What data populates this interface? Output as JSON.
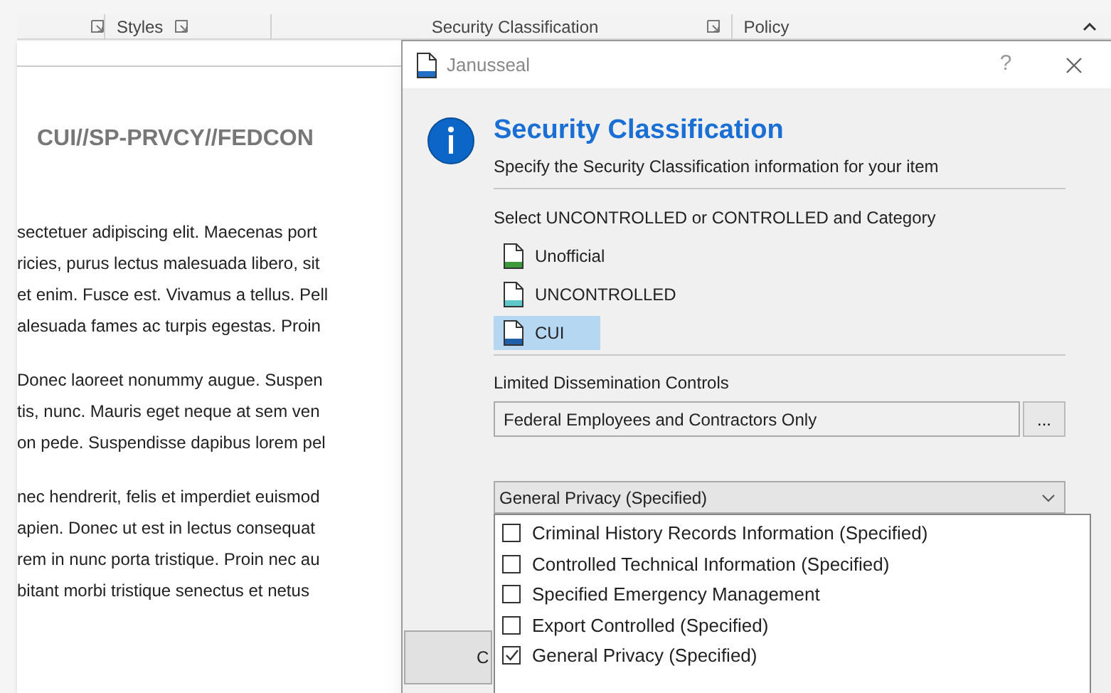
{
  "ribbon": {
    "groups": [
      {
        "label": "Styles",
        "launcher": true
      },
      {
        "label": "Security Classification",
        "launcher": true
      },
      {
        "label": "Policy",
        "launcher": false
      }
    ]
  },
  "document": {
    "banner": "CUI//SP-PRVCY//FEDCON",
    "paragraphs": [
      [
        "sectetuer adipiscing elit. Maecenas port",
        "ricies, purus lectus malesuada libero, sit",
        "et enim. Fusce est. Vivamus a tellus. Pell",
        "alesuada fames ac turpis egestas. Proin"
      ],
      [
        "Donec laoreet nonummy augue. Suspen",
        "tis, nunc. Mauris eget neque at sem ven",
        "on pede. Suspendisse dapibus lorem pel"
      ],
      [
        "nec hendrerit, felis et imperdiet euismod",
        "apien. Donec ut est in lectus consequat",
        "rem in nunc porta tristique. Proin nec au",
        "bitant morbi tristique senectus et netus"
      ]
    ]
  },
  "dialog": {
    "title": "Janusseal",
    "help": "?",
    "heading": "Security Classification",
    "subtitle": "Specify the Security Classification information for your item",
    "select_label": "Select UNCONTROLLED or CONTROLLED and Category",
    "classifications": [
      {
        "label": "Unofficial",
        "color": "#3c9a3c",
        "selected": false
      },
      {
        "label": "UNCONTROLLED",
        "color": "#5fc8c8",
        "selected": false
      },
      {
        "label": "CUI",
        "color": "#1f5fa8",
        "selected": true
      }
    ],
    "ldc_label": "Limited Dissemination Controls",
    "ldc_value": "Federal Employees and Contractors Only",
    "ldc_button": "...",
    "category": {
      "value": "General Privacy (Specified)",
      "options": [
        {
          "label": "Criminal History Records Information (Specified)",
          "checked": false
        },
        {
          "label": "Controlled Technical Information (Specified)",
          "checked": false
        },
        {
          "label": "Specified Emergency Management",
          "checked": false
        },
        {
          "label": "Export Controlled (Specified)",
          "checked": false
        },
        {
          "label": "General Privacy (Specified)",
          "checked": true
        }
      ]
    },
    "footer_button": "C"
  }
}
